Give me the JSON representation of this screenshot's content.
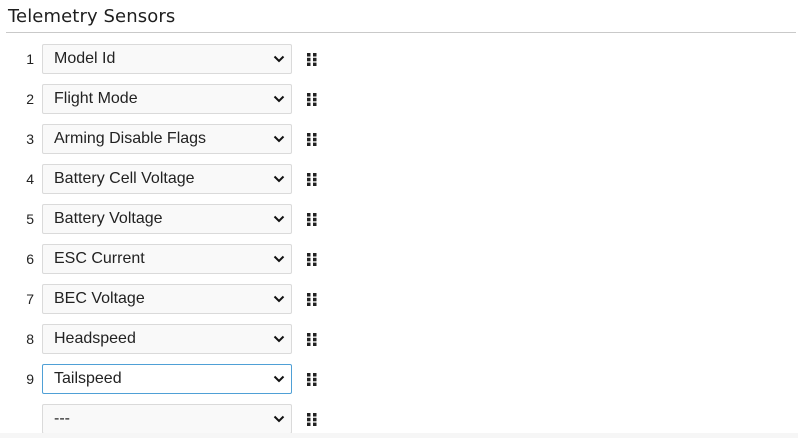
{
  "panel": {
    "title": "Telemetry Sensors"
  },
  "sensors": [
    {
      "index": "1",
      "value": "Model Id"
    },
    {
      "index": "2",
      "value": "Flight Mode"
    },
    {
      "index": "3",
      "value": "Arming Disable Flags"
    },
    {
      "index": "4",
      "value": "Battery Cell Voltage"
    },
    {
      "index": "5",
      "value": "Battery Voltage"
    },
    {
      "index": "6",
      "value": "ESC Current"
    },
    {
      "index": "7",
      "value": "BEC Voltage"
    },
    {
      "index": "8",
      "value": "Headspeed"
    },
    {
      "index": "9",
      "value": "Tailspeed"
    },
    {
      "index": "",
      "value": "---"
    }
  ],
  "focused_row": 9,
  "icons": {
    "select_arrow": "chevron-down-icon",
    "reorder": "drag-handle-icon"
  },
  "colors": {
    "focus_border": "#4fa0d6",
    "select_border": "#dadada",
    "select_background": "#f9f9f9"
  }
}
